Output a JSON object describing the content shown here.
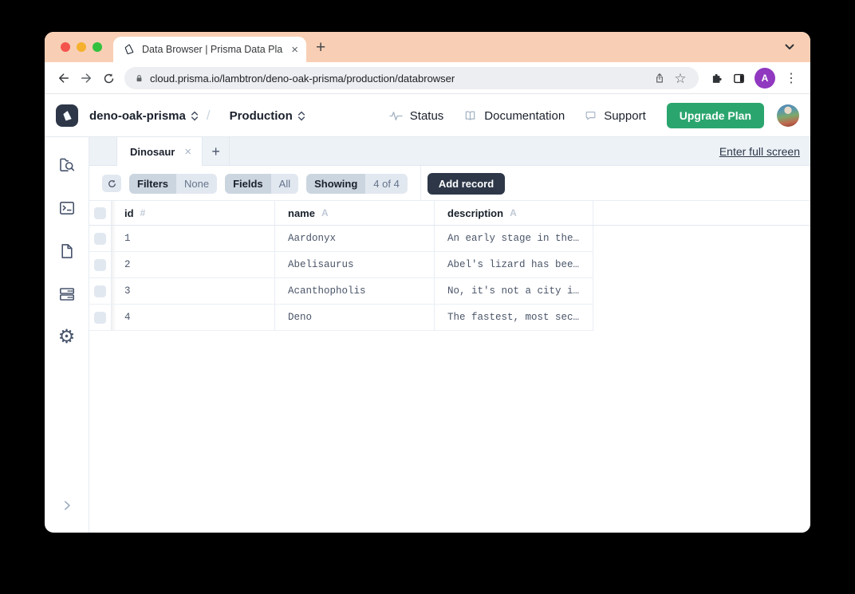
{
  "window_controls": {
    "close": "close",
    "minimize": "minimize",
    "zoom": "zoom"
  },
  "browser": {
    "tab_title": "Data Browser | Prisma Data Pla",
    "url": "cloud.prisma.io/lambtron/deno-oak-prisma/production/databrowser",
    "profile_initial": "A"
  },
  "glyphs": {
    "close": "×",
    "plus": "+",
    "star": "☆",
    "menu_dots": "⋮",
    "gear": "⚙"
  },
  "header": {
    "project": "deno-oak-prisma",
    "path_separator": "/",
    "environment": "Production",
    "status_label": "Status",
    "documentation_label": "Documentation",
    "support_label": "Support",
    "upgrade_button": "Upgrade Plan"
  },
  "sidebar": {
    "items": [
      "data-browser",
      "query-console",
      "schema-viewer",
      "databases",
      "settings"
    ]
  },
  "workspace_tabs": {
    "active_tab": "Dinosaur",
    "fullscreen_link": "Enter full screen"
  },
  "toolbar": {
    "filters_label": "Filters",
    "filters_value": "None",
    "fields_label": "Fields",
    "fields_value": "All",
    "showing_label": "Showing",
    "showing_value": "4 of 4",
    "add_record": "Add record"
  },
  "table": {
    "columns": [
      {
        "label": "id",
        "type": "#"
      },
      {
        "label": "name",
        "type": "A"
      },
      {
        "label": "description",
        "type": "A"
      }
    ],
    "rows": [
      {
        "id": "1",
        "name": "Aardonyx",
        "description": "An early stage in the…"
      },
      {
        "id": "2",
        "name": "Abelisaurus",
        "description": "Abel's lizard has bee…"
      },
      {
        "id": "3",
        "name": "Acanthopholis",
        "description": "No, it's not a city i…"
      },
      {
        "id": "4",
        "name": "Deno",
        "description": "The fastest, most sec…"
      }
    ]
  },
  "colors": {
    "chrome_peach": "#F8CFB4",
    "accent_green": "#2BA56E",
    "brand_dark": "#2D3748",
    "profile_purple": "#9038C0",
    "tabbar_gray": "#EDF2F7"
  }
}
